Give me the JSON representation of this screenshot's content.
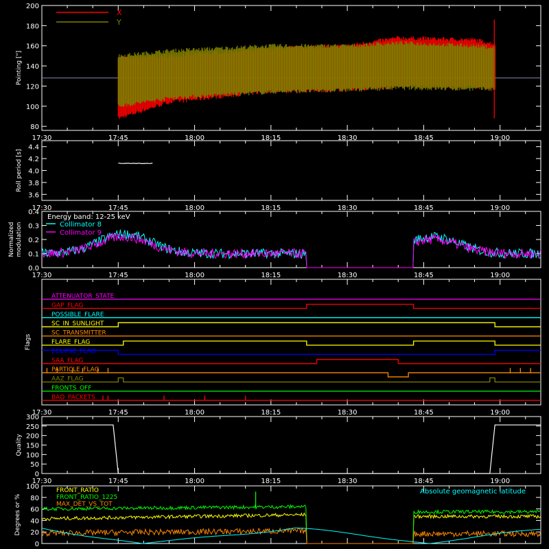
{
  "time_ticks": [
    "17:30",
    "17:45",
    "18:00",
    "18:15",
    "18:30",
    "18:45",
    "19:00"
  ],
  "colors": {
    "background": "#000000",
    "axes": "#ffffff",
    "red": "#ff0000",
    "olive": "#808000",
    "cyan": "#00ffff",
    "magenta": "#ff00ff",
    "yellow": "#ffff00",
    "green": "#00ff00",
    "orange": "#ff8800",
    "blue": "#0000ff",
    "white": "#ffffff"
  },
  "chart_data": [
    {
      "id": "pointing",
      "type": "line",
      "ylabel": "Pointing [\"]",
      "ylim": [
        76,
        200
      ],
      "yticks": [
        "80",
        "100",
        "120",
        "140",
        "160",
        "180",
        "200"
      ],
      "legend_placement": "top-left",
      "reference_line": 128,
      "series": [
        {
          "name": "X",
          "color": "#ff0000",
          "start": "17:45",
          "end": "18:59",
          "center": 128,
          "upper": [
            [
              0,
              148
            ],
            [
              10,
              150
            ],
            [
              30,
              157
            ],
            [
              45,
              160
            ],
            [
              55,
              168
            ],
            [
              70,
              166
            ],
            [
              74,
              162
            ]
          ],
          "lower": [
            [
              0,
              88
            ],
            [
              10,
              104
            ],
            [
              30,
              115
            ],
            [
              45,
              116
            ],
            [
              55,
              120
            ],
            [
              70,
              119
            ],
            [
              74,
              118
            ]
          ]
        },
        {
          "name": "Y",
          "color": "#808000",
          "start": "17:45",
          "end": "18:59",
          "center": 128,
          "upper": [
            [
              0,
              150
            ],
            [
              10,
              155
            ],
            [
              30,
              160
            ],
            [
              45,
              160
            ],
            [
              55,
              163
            ],
            [
              70,
              160
            ],
            [
              74,
              158
            ]
          ],
          "lower": [
            [
              0,
              100
            ],
            [
              10,
              108
            ],
            [
              30,
              114
            ],
            [
              45,
              116
            ],
            [
              55,
              118
            ],
            [
              70,
              117
            ],
            [
              74,
              117
            ]
          ]
        }
      ]
    },
    {
      "id": "roll_period",
      "type": "line",
      "ylabel": "Roll period [s]",
      "ylim": [
        3.5,
        4.5
      ],
      "yticks": [
        "3.6",
        "3.8",
        "4.0",
        "4.2",
        "4.4"
      ],
      "series": [
        {
          "name": "",
          "color": "#ffffff",
          "segments": [
            {
              "start": "17:45",
              "end": "17:52",
              "value": 4.12
            }
          ]
        }
      ]
    },
    {
      "id": "modulation",
      "type": "line",
      "ylabel": [
        "Normalized",
        "modulation"
      ],
      "ylim": [
        0,
        0.4
      ],
      "yticks": [
        "0.0",
        "0.1",
        "0.2",
        "0.3",
        "0.4"
      ],
      "annotation": "Energy band: 12-25 keV",
      "series": [
        {
          "name": "Collimator 8",
          "color": "#00ffff",
          "base": 0.1,
          "bump": [
            [
              17.77,
              0.24
            ],
            [
              18.78,
              0.22
            ]
          ],
          "gap": [
            "18:22",
            "18:43"
          ]
        },
        {
          "name": "Collimator 9",
          "color": "#ff00ff",
          "base": 0.1,
          "bump": [
            [
              17.77,
              0.22
            ],
            [
              18.78,
              0.2
            ]
          ],
          "gap": [
            "18:22",
            "18:43"
          ]
        }
      ]
    },
    {
      "id": "flags",
      "type": "line",
      "ylabel": "Flags",
      "series": [
        {
          "name": "ATTENUATOR_STATE",
          "color": "#ff00ff",
          "segments": [
            [
              "17:30",
              "19:08",
              0
            ]
          ]
        },
        {
          "name": "GAP_FLAG",
          "color": "#ff0000",
          "segments": [
            [
              "17:30",
              "18:22",
              0
            ],
            [
              "18:22",
              "18:43",
              1
            ],
            [
              "18:43",
              "19:08",
              0
            ]
          ]
        },
        {
          "name": "POSSIBLE_FLARE",
          "color": "#00ffff",
          "segments": [
            [
              "17:30",
              "19:08",
              0
            ]
          ]
        },
        {
          "name": "SC_IN_SUNLIGHT",
          "color": "#ffff00",
          "segments": [
            [
              "17:30",
              "17:45",
              0
            ],
            [
              "17:45",
              "18:59",
              1
            ],
            [
              "18:59",
              "19:08",
              0
            ]
          ]
        },
        {
          "name": "SC_TRANSMITTER",
          "color": "#ff8800",
          "segments": [
            [
              "17:30",
              "19:08",
              0
            ]
          ]
        },
        {
          "name": "FLARE_FLAG",
          "color": "#ffff00",
          "segments": [
            [
              "17:30",
              "17:46",
              0
            ],
            [
              "17:46",
              "18:22",
              1
            ],
            [
              "18:22",
              "18:43",
              0
            ],
            [
              "18:43",
              "18:59",
              1
            ],
            [
              "18:59",
              "19:08",
              0
            ]
          ]
        },
        {
          "name": "ECLIPSE_FLAG",
          "color": "#0000ff",
          "segments": [
            [
              "17:30",
              "17:45",
              1
            ],
            [
              "17:45",
              "18:59",
              0
            ],
            [
              "18:59",
              "19:08",
              1
            ]
          ]
        },
        {
          "name": "SAA_FLAG",
          "color": "#ff0000",
          "segments": [
            [
              "17:30",
              "18:24",
              0
            ],
            [
              "18:24",
              "18:40",
              1
            ],
            [
              "18:40",
              "19:08",
              0
            ]
          ]
        },
        {
          "name": "PARTICLE_FLAG",
          "color": "#ff8800",
          "segments": [
            [
              "17:30",
              "18:38",
              0
            ],
            [
              "18:38",
              "18:42",
              -1
            ],
            [
              "18:42",
              "19:08",
              0
            ]
          ],
          "spikes": [
            "17:31",
            "17:33",
            "17:36",
            "17:38",
            "17:41",
            "17:43",
            "19:02",
            "19:04",
            "19:06"
          ]
        },
        {
          "name": "AAZ_FLAG",
          "color": "#808000",
          "segments": [
            [
              "17:30",
              "17:45",
              0
            ],
            [
              "17:45",
              "17:46",
              1
            ],
            [
              "17:46",
              "18:58",
              0
            ],
            [
              "18:58",
              "18:59",
              1
            ],
            [
              "18:59",
              "19:08",
              0
            ]
          ]
        },
        {
          "name": "FRONTS_OFF",
          "color": "#00ff00",
          "segments": [
            [
              "17:30",
              "19:08",
              0
            ]
          ]
        },
        {
          "name": "BAD_PACKETS",
          "color": "#ff0000",
          "segments": [
            [
              "17:30",
              "19:08",
              0
            ]
          ],
          "spikes": [
            "17:42",
            "17:43",
            "17:54",
            "18:02",
            "18:10"
          ]
        }
      ]
    },
    {
      "id": "quality",
      "type": "line",
      "ylabel": "Quality",
      "ylim": [
        0,
        300
      ],
      "yticks": [
        "0",
        "50",
        "100",
        "150",
        "200",
        "250",
        "300"
      ],
      "series": [
        {
          "name": "",
          "color": "#ffffff",
          "segments": [
            [
              "17:30",
              "17:44",
              256
            ],
            [
              "17:45",
              "18:58",
              0
            ],
            [
              "18:59",
              "19:08",
              256
            ]
          ]
        }
      ]
    },
    {
      "id": "geomagnetic",
      "type": "line",
      "ylabel": "Degrees or %",
      "ylim": [
        0,
        100
      ],
      "yticks": [
        "0",
        "20",
        "40",
        "60",
        "80",
        "100"
      ],
      "annotation": "Absolute geomagnetic latitude",
      "series": [
        {
          "name": "FRONT_RATIO",
          "color": "#ffff00",
          "levels": [
            [
              17.5,
              43
            ],
            [
              18.36,
              50
            ]
          ],
          "gap": [
            "18:22",
            "18:43"
          ],
          "after": 47
        },
        {
          "name": "FRONT_RATIO_1225",
          "color": "#00ff00",
          "levels": [
            [
              17.5,
              60
            ],
            [
              18.36,
              64
            ]
          ],
          "gap": [
            "18:22",
            "18:43"
          ],
          "after": 55
        },
        {
          "name": "MAX_DET_VS_TOT",
          "color": "#ff8800",
          "levels": [
            [
              17.5,
              18
            ],
            [
              18.36,
              22
            ]
          ],
          "gap": [
            "18:22",
            "18:43"
          ],
          "after": 17
        },
        {
          "name": "",
          "color": "#00ffff",
          "latitude": [
            [
              17.5,
              28
            ],
            [
              17.83,
              0
            ],
            [
              18.33,
              30
            ],
            [
              18.77,
              0
            ],
            [
              19.13,
              28
            ]
          ]
        }
      ]
    }
  ]
}
